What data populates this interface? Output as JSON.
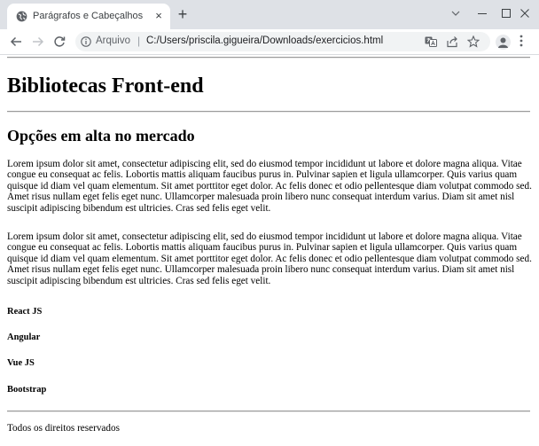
{
  "browser": {
    "tab": {
      "title": "Parágrafos e Cabeçalhos",
      "close_glyph": "×",
      "favicon": "globe-icon"
    },
    "new_tab_glyph": "+",
    "window_controls": [
      "chevron-down-icon",
      "minimize-icon",
      "maximize-icon",
      "close-icon"
    ],
    "address_bar": {
      "scheme_label": "Arquivo",
      "separator": "|",
      "url": "C:/Users/priscila.gigueira/Downloads/exercicios.html"
    },
    "toolbar_icons": [
      "back-icon",
      "forward-icon",
      "reload-icon",
      "info-icon",
      "translate-icon",
      "share-icon",
      "bookmark-star-icon",
      "profile-icon",
      "menu-icon"
    ]
  },
  "page": {
    "h1": "Bibliotecas Front-end",
    "h2": "Opções em alta no mercado",
    "paragraphs": [
      "Lorem ipsum dolor sit amet, consectetur adipiscing elit, sed do eiusmod tempor incididunt ut labore et dolore magna aliqua. Vitae congue eu consequat ac felis. Lobortis mattis aliquam faucibus purus in. Pulvinar sapien et ligula ullamcorper. Quis varius quam quisque id diam vel quam elementum. Sit amet porttitor eget dolor. Ac felis donec et odio pellentesque diam volutpat commodo sed. Amet risus nullam eget felis eget nunc. Ullamcorper malesuada proin libero nunc consequat interdum varius. Diam sit amet nisl suscipit adipiscing bibendum est ultricies. Cras sed felis eget velit.",
      "Lorem ipsum dolor sit amet, consectetur adipiscing elit, sed do eiusmod tempor incididunt ut labore et dolore magna aliqua. Vitae congue eu consequat ac felis. Lobortis mattis aliquam faucibus purus in. Pulvinar sapien et ligula ullamcorper. Quis varius quam quisque id diam vel quam elementum. Sit amet porttitor eget dolor. Ac felis donec et odio pellentesque diam volutpat commodo sed. Amet risus nullam eget felis eget nunc. Ullamcorper malesuada proin libero nunc consequat interdum varius. Diam sit amet nisl suscipit adipiscing bibendum est ultricies. Cras sed felis eget velit."
    ],
    "libraries": [
      "React JS",
      "Angular",
      "Vue JS",
      "Bootstrap"
    ],
    "footer": "Todos os direitos reservados"
  }
}
